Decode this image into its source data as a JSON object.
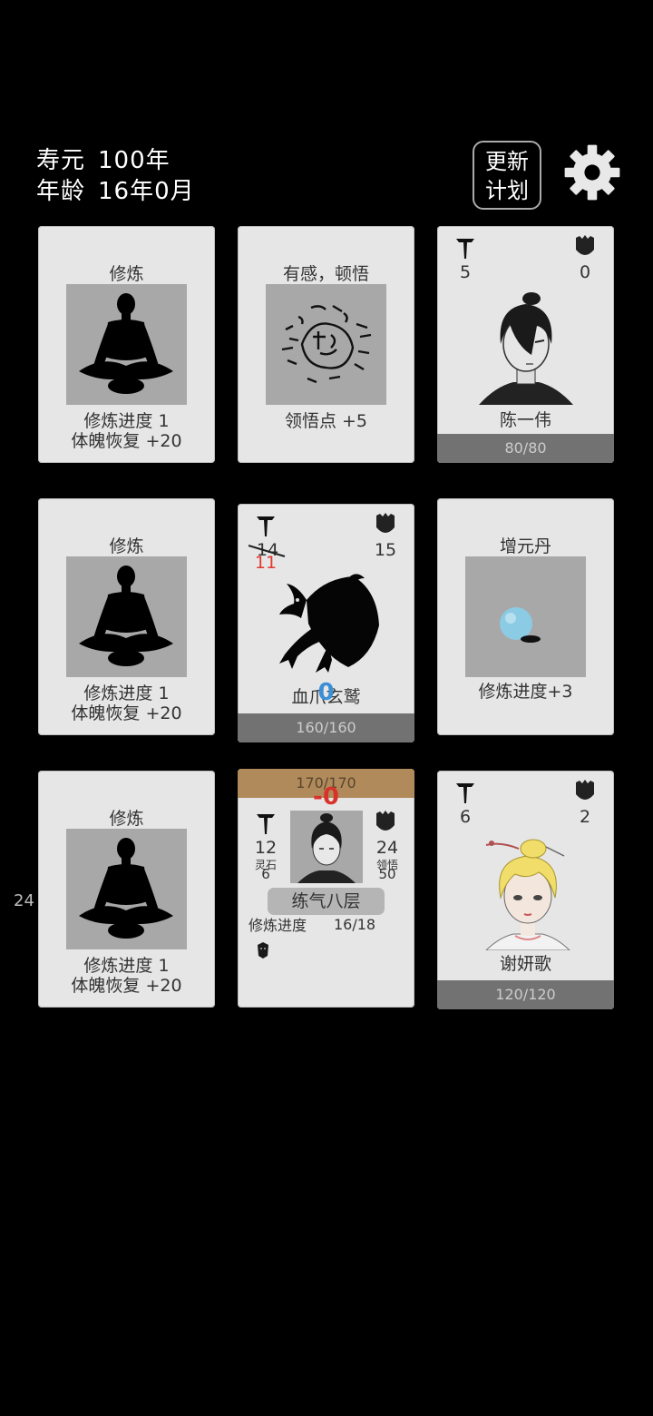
{
  "hud": {
    "lifespan_label": "寿元",
    "lifespan_value": "100年",
    "age_label": "年龄",
    "age_value": "16年0月",
    "plan_button_line1": "更新",
    "plan_button_line2": "计划",
    "side_number": "24"
  },
  "cards": {
    "cultivate1": {
      "title": "修炼",
      "line1": "修炼进度  1",
      "line2": "体魄恢复  +20"
    },
    "insight": {
      "title": "有感，顿悟",
      "line1": "领悟点  +5"
    },
    "chen": {
      "attack": "5",
      "defense": "0",
      "name": "陈一伟",
      "hp": "80/80"
    },
    "cultivate2": {
      "title": "修炼",
      "line1": "修炼进度  1",
      "line2": "体魄恢复  +20"
    },
    "monster": {
      "attack_old": "14",
      "attack_new": "11",
      "defense": "15",
      "name": "血爪玄鹫",
      "damage": "-0",
      "hp": "160/160"
    },
    "pill": {
      "title": "增元丹",
      "line1": "修炼进度+3"
    },
    "cultivate3": {
      "title": "修炼",
      "line1": "修炼进度  1",
      "line2": "体魄恢复  +20"
    },
    "player": {
      "hp": "170/170",
      "damage": "-0",
      "attack": "12",
      "spirit_stone_label": "灵石",
      "spirit_stone": "6",
      "defense": "24",
      "insight_label": "领悟",
      "insight": "50",
      "realm": "练气八层",
      "progress_label": "修炼进度",
      "progress": "16/18"
    },
    "xie": {
      "attack": "6",
      "defense": "2",
      "name": "谢妍歌",
      "hp": "120/120"
    }
  },
  "colors": {
    "hp_bar": "#727272",
    "damage": "#d9322a",
    "player_hp_bar": "#b08a5a"
  },
  "icons": [
    "gear-icon",
    "sword-icon",
    "shield-icon",
    "meditation-icon",
    "insight-characters-icon",
    "monster-icon",
    "pill-icon"
  ]
}
